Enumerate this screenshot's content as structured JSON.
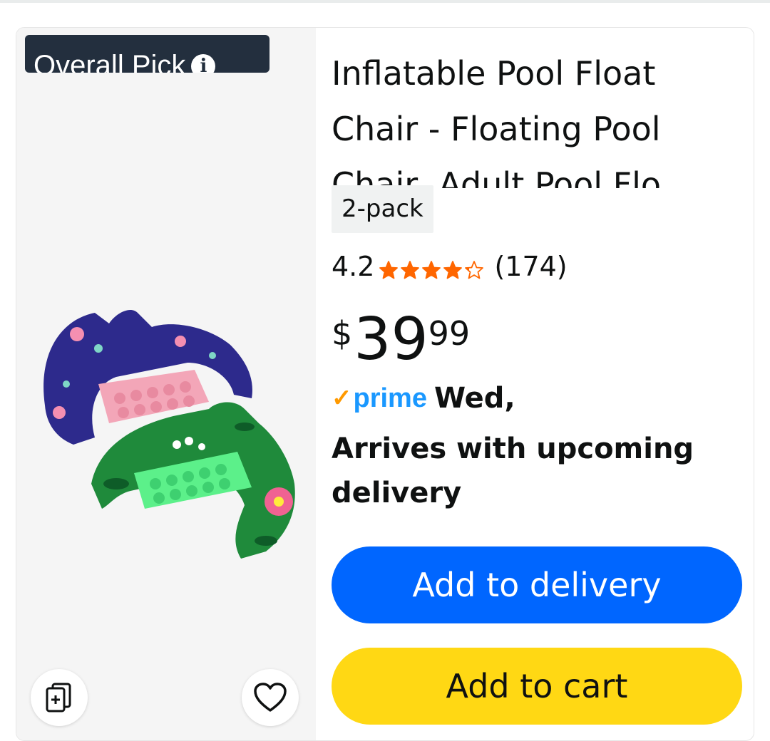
{
  "product": {
    "badge": "Overall Pick",
    "title": "Inflatable Pool Float Chair - Floating Pool Chair, Adult Pool Flo",
    "pack": "2-pack",
    "rating": "4.2",
    "rating_value": 4.2,
    "rating_max": 5,
    "review_count": "(174)",
    "price": {
      "symbol": "$",
      "whole": "39",
      "fraction": "99"
    },
    "prime": {
      "label": "prime",
      "delivery_day": "Wed,"
    },
    "delivery_note": "Arrives with upcoming delivery",
    "buttons": {
      "add_to_delivery": "Add to delivery",
      "add_to_cart": "Add to cart"
    }
  },
  "icons": {
    "badge": "info-icon",
    "compare": "compare-add-icon",
    "wishlist": "heart-icon"
  },
  "colors": {
    "badge_bg": "#232f3e",
    "star": "#ff6600",
    "prime": "#1a98ff",
    "prime_check": "#ff9900",
    "add_to_delivery_bg": "#0066ff",
    "add_to_cart_bg": "#ffd814"
  }
}
